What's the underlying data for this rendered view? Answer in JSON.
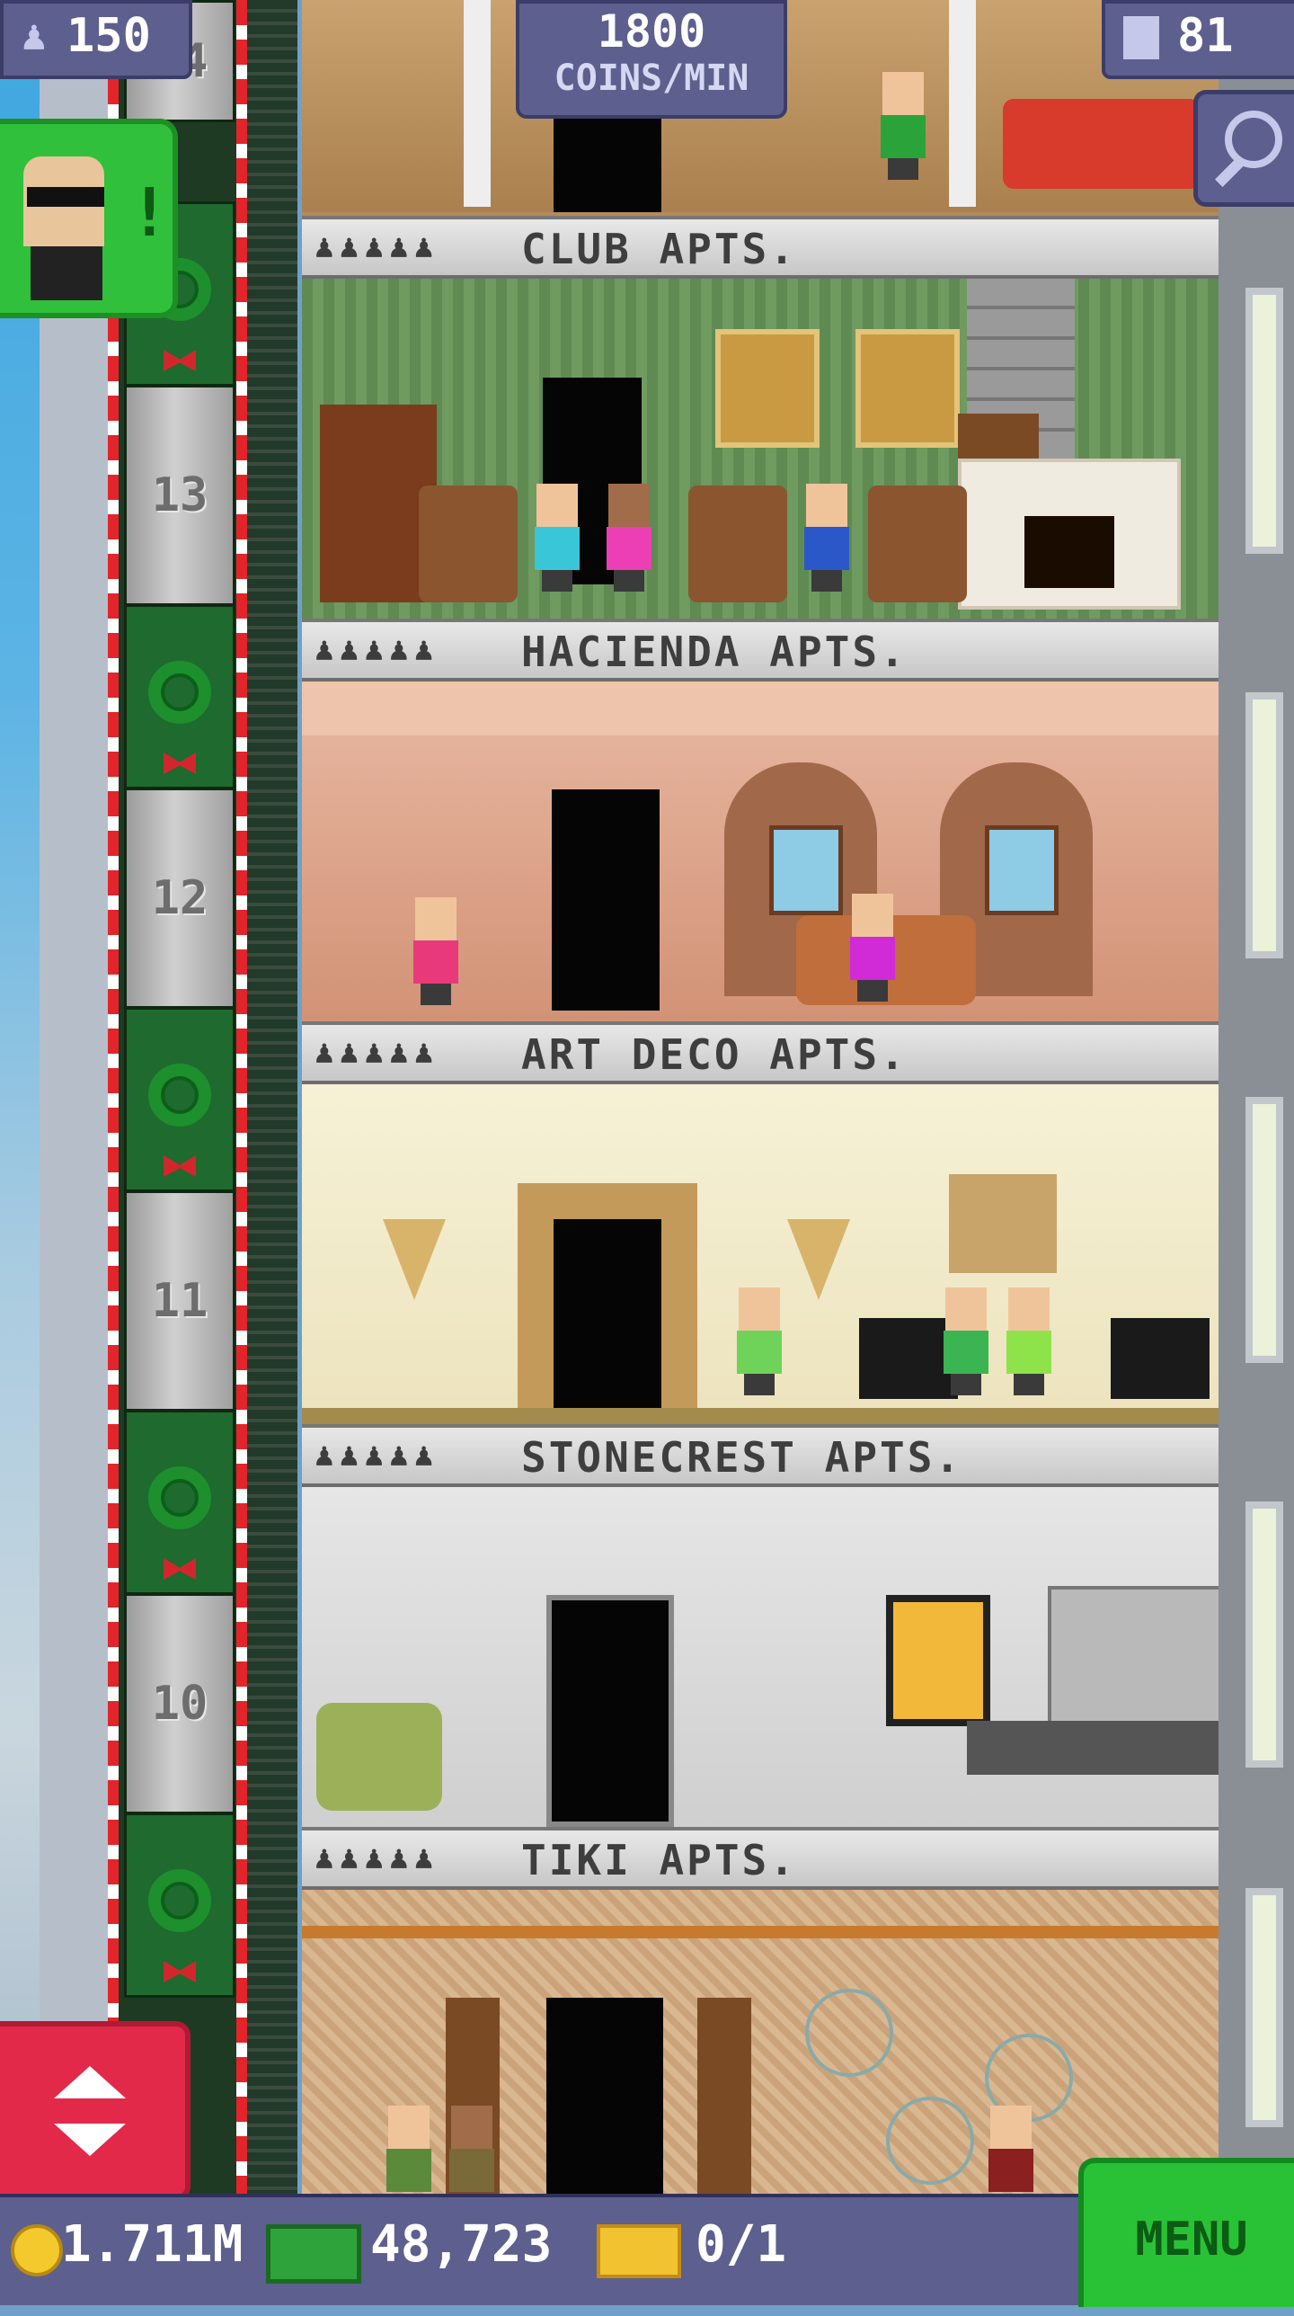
{
  "hud": {
    "population": "150",
    "coins_rate_top": "1800",
    "coins_rate_bottom": "COINS/MIN",
    "floors": "81"
  },
  "elevator_floor_labels": [
    "14",
    "13",
    "12",
    "11",
    "10"
  ],
  "floors": [
    {
      "name": "CLUB APTS.",
      "residents": "♟♟♟♟♟"
    },
    {
      "name": "HACIENDA APTS.",
      "residents": "♟♟♟♟♟"
    },
    {
      "name": "ART DECO APTS.",
      "residents": "♟♟♟♟♟"
    },
    {
      "name": "STONECREST APTS.",
      "residents": "♟♟♟♟♟"
    },
    {
      "name": "TIKI APTS.",
      "residents": "♟♟♟♟♟"
    }
  ],
  "vip": {
    "alert": "!"
  },
  "bottom": {
    "coins": "1.711M",
    "bux": "48,723",
    "tickets": "0/1",
    "menu": "MENU"
  },
  "colors": {
    "hud_bg": "#5d5f8e",
    "menu_green": "#29c237",
    "elevator_red": "#e2294a"
  }
}
